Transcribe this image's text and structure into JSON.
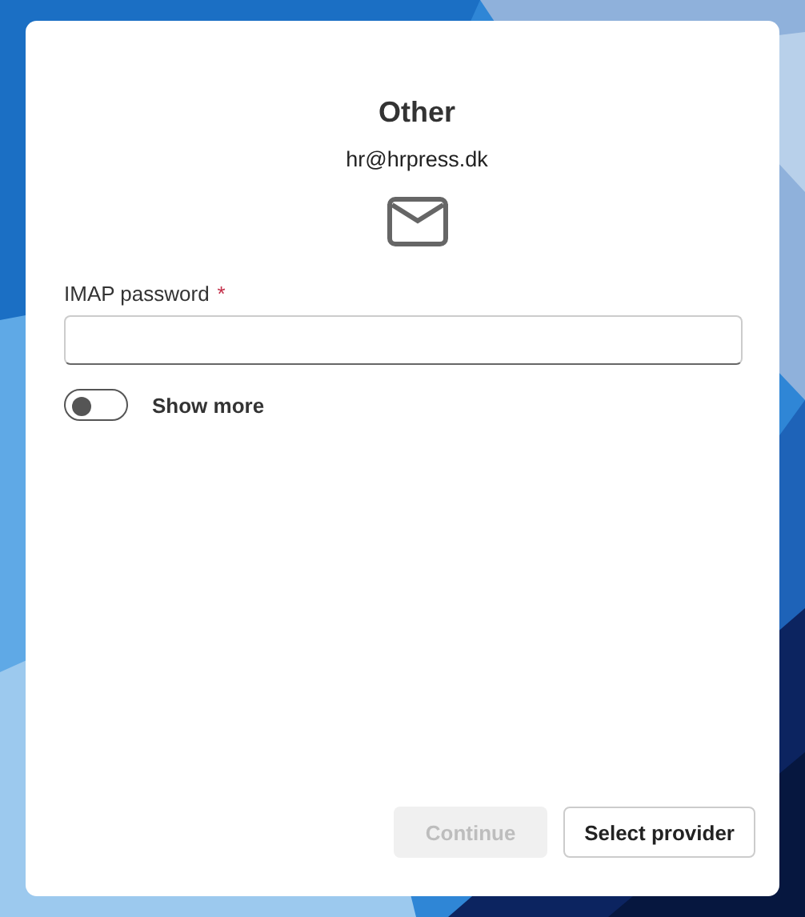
{
  "dialog": {
    "title": "Other",
    "email": "hr@hrpress.dk"
  },
  "password_field": {
    "label": "IMAP password",
    "required_mark": "*",
    "required": true
  },
  "toggle": {
    "label": "Show more",
    "on": false
  },
  "buttons": [
    {
      "label": "Continue",
      "kind": "primary",
      "disabled": true
    },
    {
      "label": "Select provider",
      "kind": "secondary",
      "disabled": false
    }
  ]
}
